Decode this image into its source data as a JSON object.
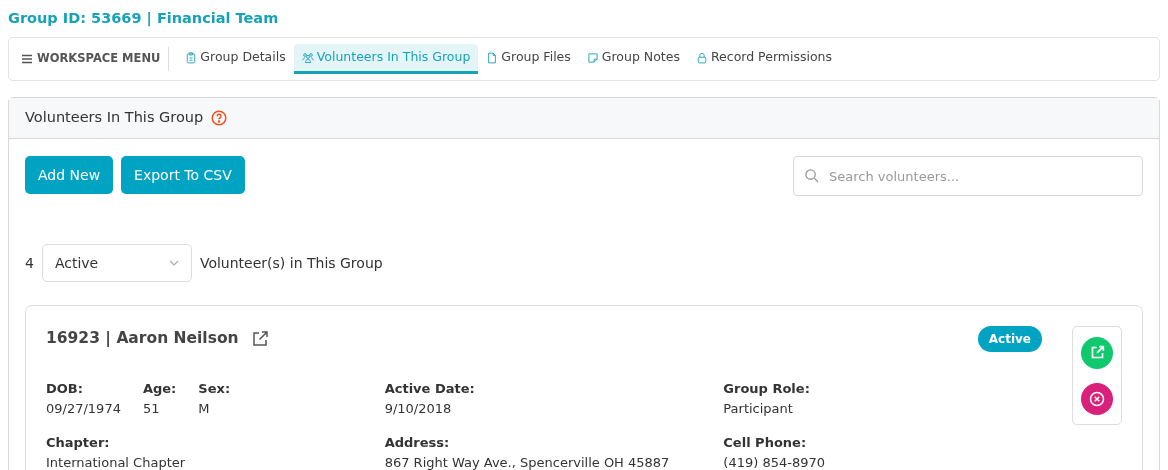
{
  "page_title": "Group ID: 53669 | Financial Team",
  "workspace_menu": {
    "label": "WORKSPACE MENU"
  },
  "tabs": [
    {
      "label": "Group Details",
      "kind": "clipboard",
      "selected": false
    },
    {
      "label": "Volunteers In This Group",
      "kind": "people",
      "selected": true
    },
    {
      "label": "Group Files",
      "kind": "file",
      "selected": false
    },
    {
      "label": "Group Notes",
      "kind": "note",
      "selected": false
    },
    {
      "label": "Record Permissions",
      "kind": "lock",
      "selected": false
    }
  ],
  "panel": {
    "title": "Volunteers In This Group",
    "buttons": [
      "Add New",
      "Export To CSV"
    ],
    "search": {
      "placeholder": "Search volunteers..."
    },
    "count": "4",
    "status_filter": "Active",
    "count_label": "Volunteer(s) in This Group",
    "volunteers": [
      {
        "title": "16923 | Aaron Neilson",
        "status": "Active",
        "fields": [
          [
            {
              "label": "DOB:",
              "value": "09/27/1974"
            },
            {
              "label": "Age:",
              "value": "51"
            },
            {
              "label": "Sex:",
              "value": "M"
            }
          ],
          [
            {
              "label": "Active Date:",
              "value": "9/10/2018"
            }
          ],
          [
            {
              "label": "Group Role:",
              "value": "Participant"
            }
          ],
          [
            {
              "label": "Chapter:",
              "value": "International Chapter"
            }
          ],
          [
            {
              "label": "Address:",
              "value": "867 Right Way Ave., Spencerville OH 45887"
            }
          ],
          [
            {
              "label": "Cell Phone:",
              "value": "(419) 854-8970"
            }
          ]
        ]
      }
    ]
  }
}
